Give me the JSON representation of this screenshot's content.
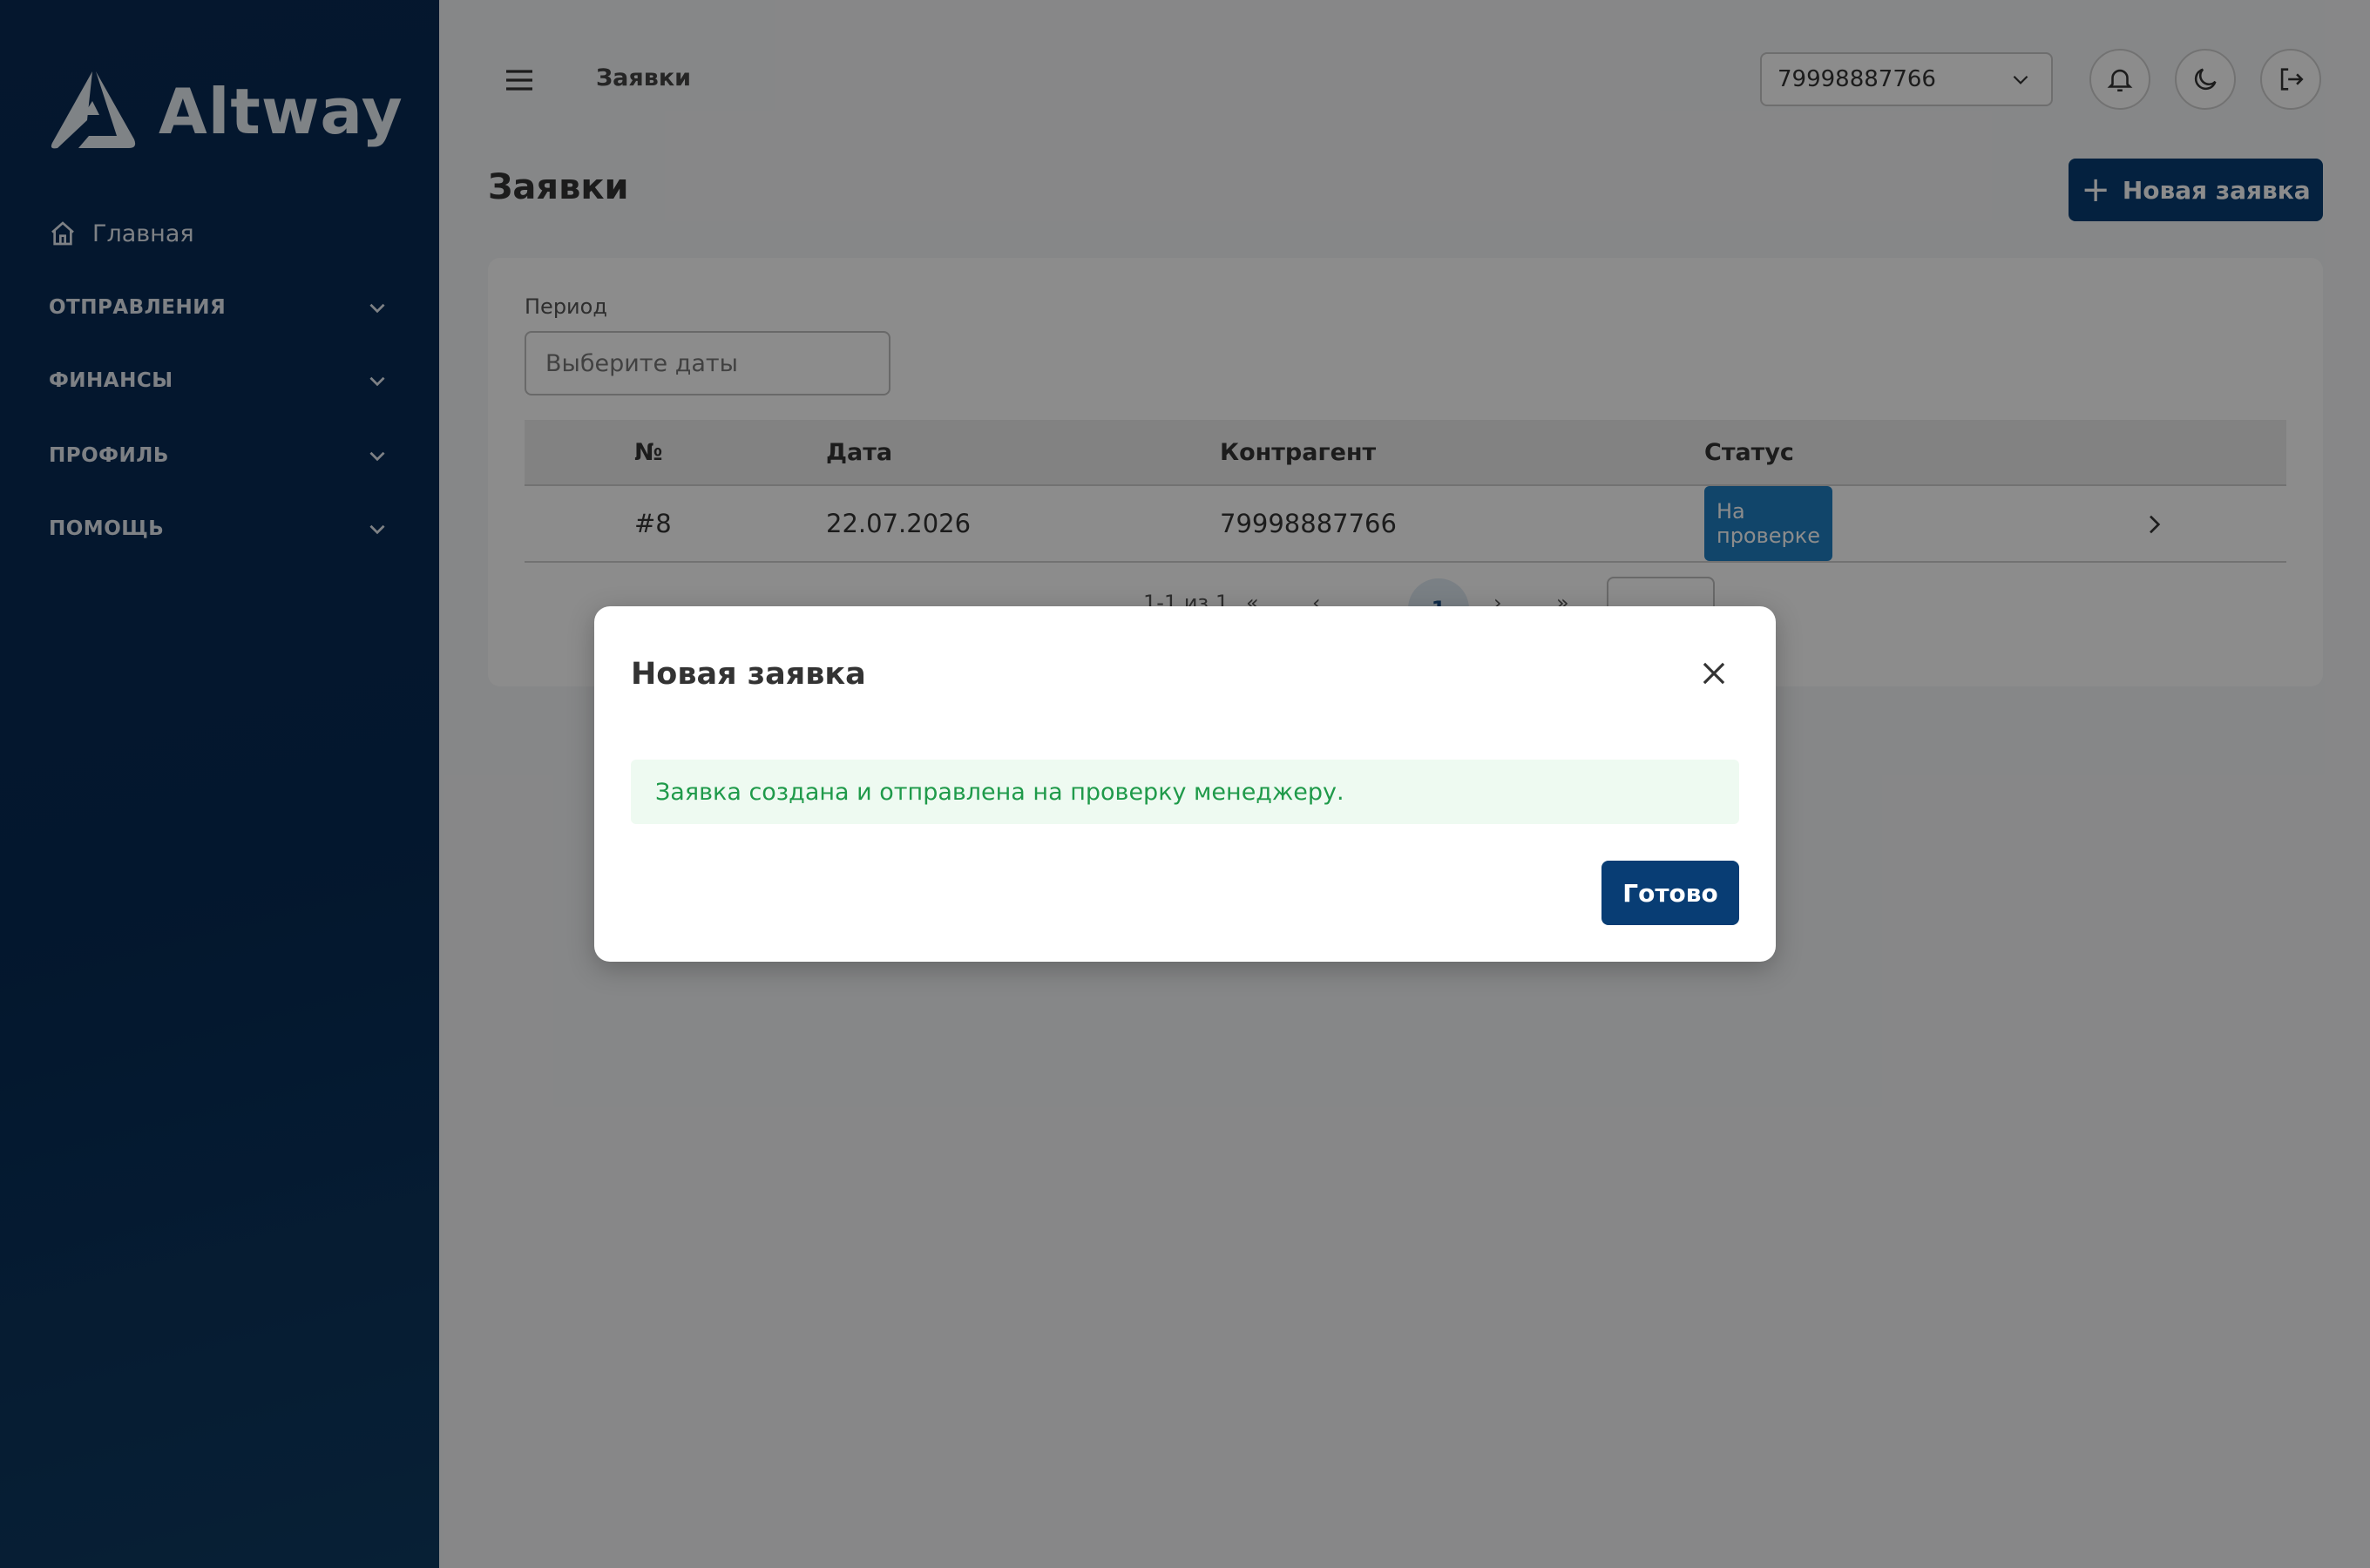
{
  "brand": {
    "name": "Altway"
  },
  "sidebar": {
    "home": {
      "label": "Главная",
      "icon": "home-icon"
    },
    "groups": [
      {
        "label": "ОТПРАВЛЕНИЯ"
      },
      {
        "label": "ФИНАНСЫ"
      },
      {
        "label": "ПРОФИЛЬ"
      },
      {
        "label": "ПОМОЩЬ"
      }
    ]
  },
  "topbar": {
    "title": "Заявки",
    "phone": "79998887766"
  },
  "page": {
    "title": "Заявки",
    "new_button": "Новая заявка",
    "filter": {
      "label": "Период",
      "placeholder": "Выберите даты"
    },
    "table": {
      "columns": [
        "№",
        "Дата",
        "Контрагент",
        "Статус"
      ],
      "rows": [
        {
          "number": "#8",
          "date": "22.07.2026",
          "counterparty": "79998887766",
          "status": "На проверке"
        }
      ]
    },
    "pagination": {
      "range": "1-1 из 1",
      "current": "1"
    }
  },
  "modal": {
    "title": "Новая заявка",
    "message": "Заявка создана и отправлена на проверку менеджеру.",
    "done_button": "Готово"
  },
  "colors": {
    "brand_dark": "#083d74",
    "sidebar": "#072a54",
    "status": "#1f7fc2",
    "success_text": "#1f9a4a",
    "success_bg": "#eefaf1"
  }
}
